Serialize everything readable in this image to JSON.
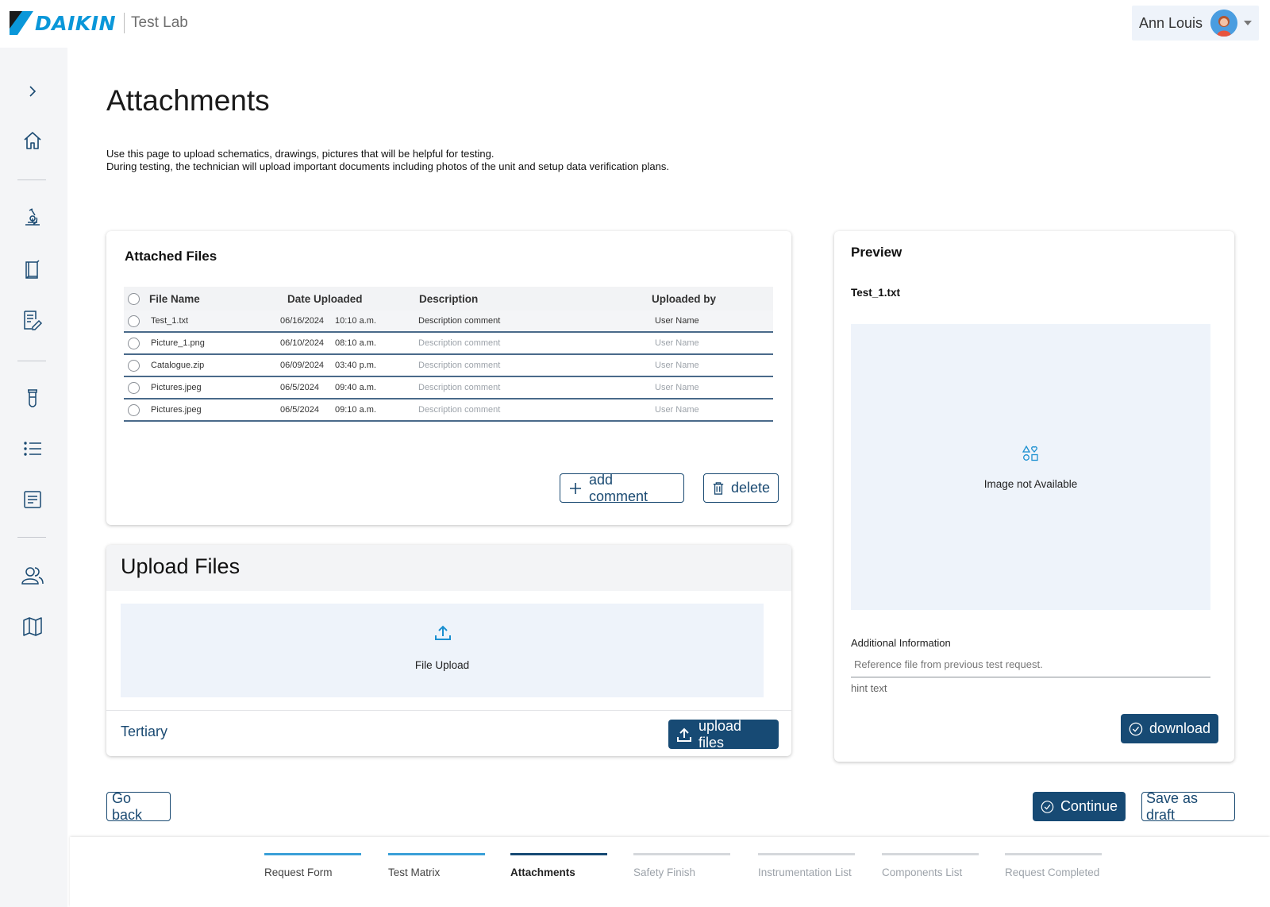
{
  "header": {
    "brand": "DAIKIN",
    "app_name": "Test Lab",
    "user_name": "Ann Louis"
  },
  "colors": {
    "brand_blue": "#0a97d9",
    "primary": "#174a74",
    "step_done": "#3aa0d8",
    "panel_bg": "#eef3fa"
  },
  "sidebar": {
    "icons": [
      "chevron-right-icon",
      "home-icon",
      "microscope-icon",
      "book-icon",
      "document-edit-icon",
      "test-tube-icon",
      "list-icon",
      "document-list-icon",
      "users-icon",
      "map-icon"
    ]
  },
  "page": {
    "title": "Attachments",
    "description_line1": "Use this page to upload schematics, drawings, pictures that will be helpful for testing.",
    "description_line2": "During testing, the technician will upload important documents including photos of the unit and setup data verification plans."
  },
  "attached_files": {
    "title": "Attached Files",
    "columns": [
      "File Name",
      "Date Uploaded",
      "Description",
      "Uploaded by"
    ],
    "rows": [
      {
        "file": "Test_1.txt",
        "date": "06/16/2024",
        "time": "10:10 a.m.",
        "description": "Description comment",
        "uploaded_by": "User Name",
        "selected": true
      },
      {
        "file": "Picture_1.png",
        "date": "06/10/2024",
        "time": "08:10 a.m.",
        "description": "Description comment",
        "uploaded_by": "User Name",
        "selected": false
      },
      {
        "file": "Catalogue.zip",
        "date": "06/09/2024",
        "time": "03:40 p.m.",
        "description": "Description comment",
        "uploaded_by": "User Name",
        "selected": false
      },
      {
        "file": "Pictures.jpeg",
        "date": "06/5/2024",
        "time": "09:40 a.m.",
        "description": "Description comment",
        "uploaded_by": "User Name",
        "selected": false
      },
      {
        "file": "Pictures.jpeg",
        "date": "06/5/2024",
        "time": "09:10 a.m.",
        "description": "Description comment",
        "uploaded_by": "User Name",
        "selected": false
      }
    ],
    "add_comment_label": "add comment",
    "delete_label": "delete"
  },
  "upload": {
    "title": "Upload Files",
    "dropzone_label": "File Upload",
    "tertiary_label": "Tertiary",
    "upload_button_label": "upload files"
  },
  "preview": {
    "title": "Preview",
    "file_name": "Test_1.txt",
    "image_placeholder": "Image not Available",
    "field_label": "Additional Information",
    "field_value": "Reference file from previous test request.",
    "hint": "hint text",
    "download_label": "download"
  },
  "actions": {
    "go_back": "Go back",
    "continue": "Continue",
    "save_draft": "Save as draft"
  },
  "stepper": {
    "steps": [
      {
        "label": "Request Form",
        "state": "done"
      },
      {
        "label": "Test Matrix",
        "state": "done"
      },
      {
        "label": "Attachments",
        "state": "active"
      },
      {
        "label": "Safety Finish",
        "state": "pending"
      },
      {
        "label": "Instrumentation List",
        "state": "pending"
      },
      {
        "label": "Components List",
        "state": "pending"
      },
      {
        "label": "Request Completed",
        "state": "pending"
      }
    ]
  }
}
